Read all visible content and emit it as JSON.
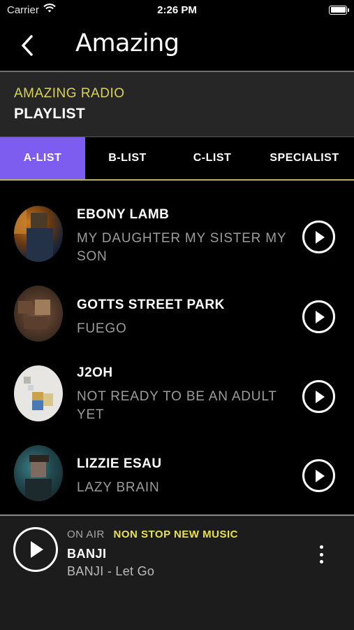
{
  "status_bar": {
    "carrier": "Carrier",
    "time": "2:26 PM"
  },
  "nav": {
    "logo": "Amazing"
  },
  "header": {
    "subtitle": "AMAZING RADIO",
    "title": "PLAYLIST"
  },
  "tabs": [
    {
      "label": "A-LIST",
      "active": true
    },
    {
      "label": "B-LIST",
      "active": false
    },
    {
      "label": "C-LIST",
      "active": false
    },
    {
      "label": "SPECIALIST",
      "active": false
    }
  ],
  "tracks": [
    {
      "artist": "EBONY LAMB",
      "song": "MY DAUGHTER MY SISTER MY SON"
    },
    {
      "artist": "GOTTS STREET PARK",
      "song": "FUEGO"
    },
    {
      "artist": "J2OH",
      "song": "NOT READY TO BE AN ADULT YET"
    },
    {
      "artist": "LIZZIE ESAU",
      "song": "LAZY BRAIN"
    }
  ],
  "player": {
    "on_air_label": "ON AIR",
    "show": "NON STOP NEW MUSIC",
    "artist": "BANJI",
    "track": "BANJI - Let Go"
  },
  "colors": {
    "accent": "#7d5cf0",
    "yellow": "#e9e24a",
    "subtitle": "#d8d357",
    "muted": "#9c9c9c"
  },
  "icons": [
    "wifi-icon",
    "battery-icon",
    "back-chevron-icon",
    "play-icon",
    "more-vertical-icon"
  ]
}
